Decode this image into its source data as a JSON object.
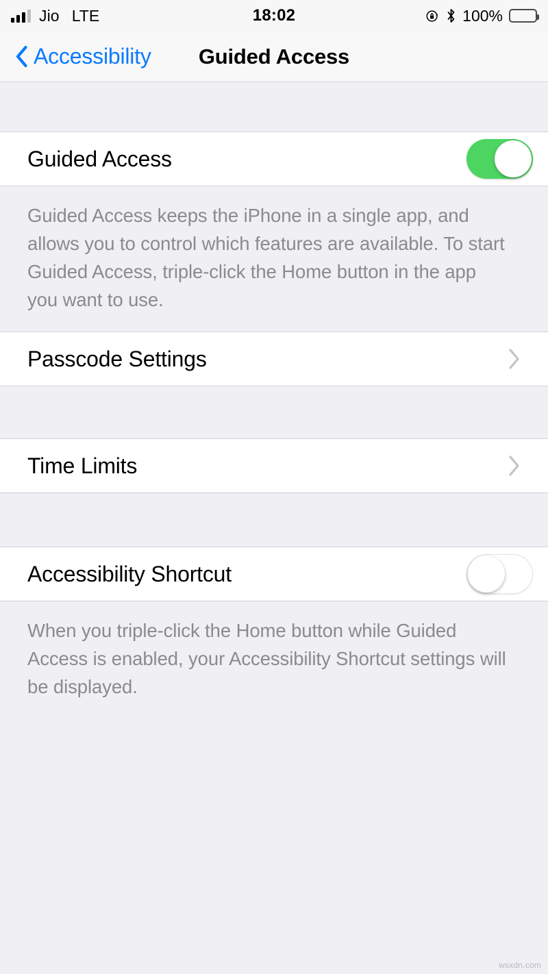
{
  "status_bar": {
    "carrier": "Jio",
    "network": "LTE",
    "time": "18:02",
    "battery_percent": "100%",
    "icons": {
      "signal": "signal-bars-icon",
      "rotation_lock": "rotation-lock-icon",
      "bluetooth": "bluetooth-icon",
      "battery": "battery-full-icon"
    }
  },
  "nav": {
    "back_label": "Accessibility",
    "title": "Guided Access",
    "back_icon": "chevron-left-icon",
    "accent_color": "#0A7AFF"
  },
  "sections": {
    "guided_access": {
      "label": "Guided Access",
      "toggle_state": "on",
      "toggle_color": "#4CD661",
      "footer": "Guided Access keeps the iPhone in a single app, and allows you to control which features are available. To start Guided Access, triple-click the Home button in the app you want to use."
    },
    "passcode_settings": {
      "label": "Passcode Settings",
      "disclosure_icon": "chevron-right-icon"
    },
    "time_limits": {
      "label": "Time Limits",
      "disclosure_icon": "chevron-right-icon"
    },
    "accessibility_shortcut": {
      "label": "Accessibility Shortcut",
      "toggle_state": "off",
      "footer": "When you triple-click the Home button while Guided Access is enabled, your Accessibility Shortcut settings will be displayed."
    }
  },
  "watermark": "wsxdn.com"
}
